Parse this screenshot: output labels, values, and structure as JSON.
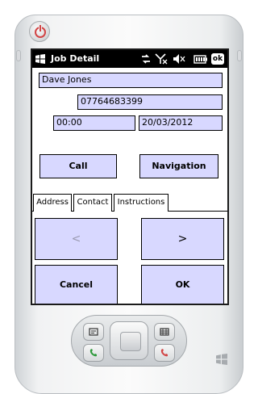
{
  "app": {
    "title": "Job Detail"
  },
  "contact": {
    "name": "Dave Jones",
    "phone": "07764683399",
    "time": "00:00",
    "date": "20/03/2012"
  },
  "actions": {
    "call_label": "Call",
    "navigation_label": "Navigation",
    "prev_label": "<",
    "next_label": ">",
    "cancel_label": "Cancel",
    "ok_label": "OK"
  },
  "tabs": [
    {
      "label": "Address",
      "active": false
    },
    {
      "label": "Contact",
      "active": true
    },
    {
      "label": "Instructions",
      "active": false
    }
  ],
  "status": {
    "ok_icon_text": "ok"
  },
  "colors": {
    "field_bg": "#d8d8ff",
    "titlebar_bg": "#000000",
    "power_red": "#d24545",
    "call_green": "#2e9a3c",
    "end_red": "#d24545"
  }
}
